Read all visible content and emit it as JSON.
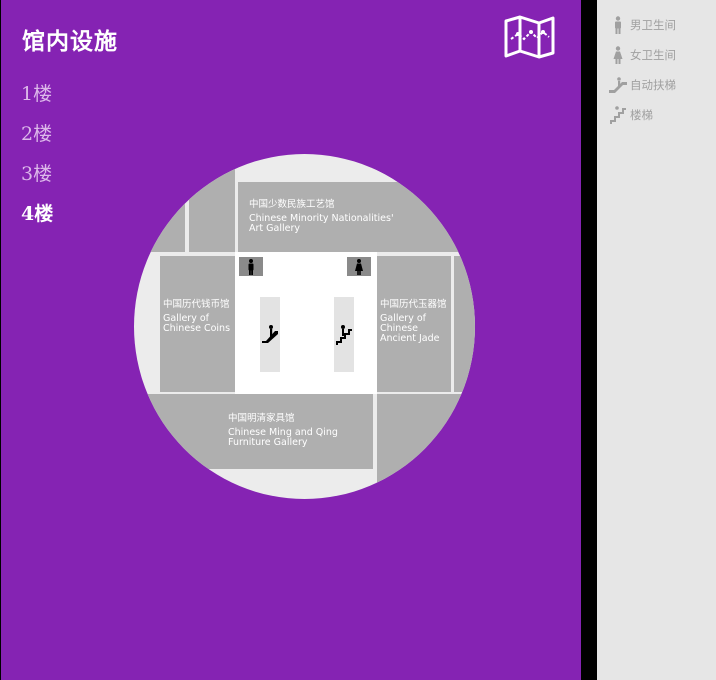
{
  "header": {
    "title": "馆内设施"
  },
  "floors": [
    {
      "label": "1楼",
      "active": false
    },
    {
      "label": "2楼",
      "active": false
    },
    {
      "label": "3楼",
      "active": false
    },
    {
      "label": "4楼",
      "active": true
    }
  ],
  "map": {
    "rooms": {
      "top": {
        "cn": "中国少数民族工艺馆",
        "en_line1": "Chinese Minority Nationalities'",
        "en_line2": "Art Gallery"
      },
      "left": {
        "cn": "中国历代钱币馆",
        "en_line1": "Gallery of",
        "en_line2": "Chinese Coins"
      },
      "right": {
        "cn": "中国历代玉器馆",
        "en_line1": "Gallery of",
        "en_line2": "Chinese",
        "en_line3": "Ancient Jade"
      },
      "bottom": {
        "cn": "中国明清家具馆",
        "en_line1": "Chinese Ming and Qing",
        "en_line2": "Furniture Gallery"
      }
    }
  },
  "legend": {
    "items": [
      {
        "label": "男卫生间",
        "icon": "male-restroom-icon"
      },
      {
        "label": "女卫生间",
        "icon": "female-restroom-icon"
      },
      {
        "label": "自动扶梯",
        "icon": "escalator-icon"
      },
      {
        "label": "楼梯",
        "icon": "stairs-icon"
      }
    ]
  },
  "colors": {
    "panel_bg": "#8523b3",
    "legend_bg": "#e6e6e6",
    "room_gray": "#afafaf",
    "floor_inactive": "#dcb8ea",
    "floor_active": "#ffffff"
  }
}
